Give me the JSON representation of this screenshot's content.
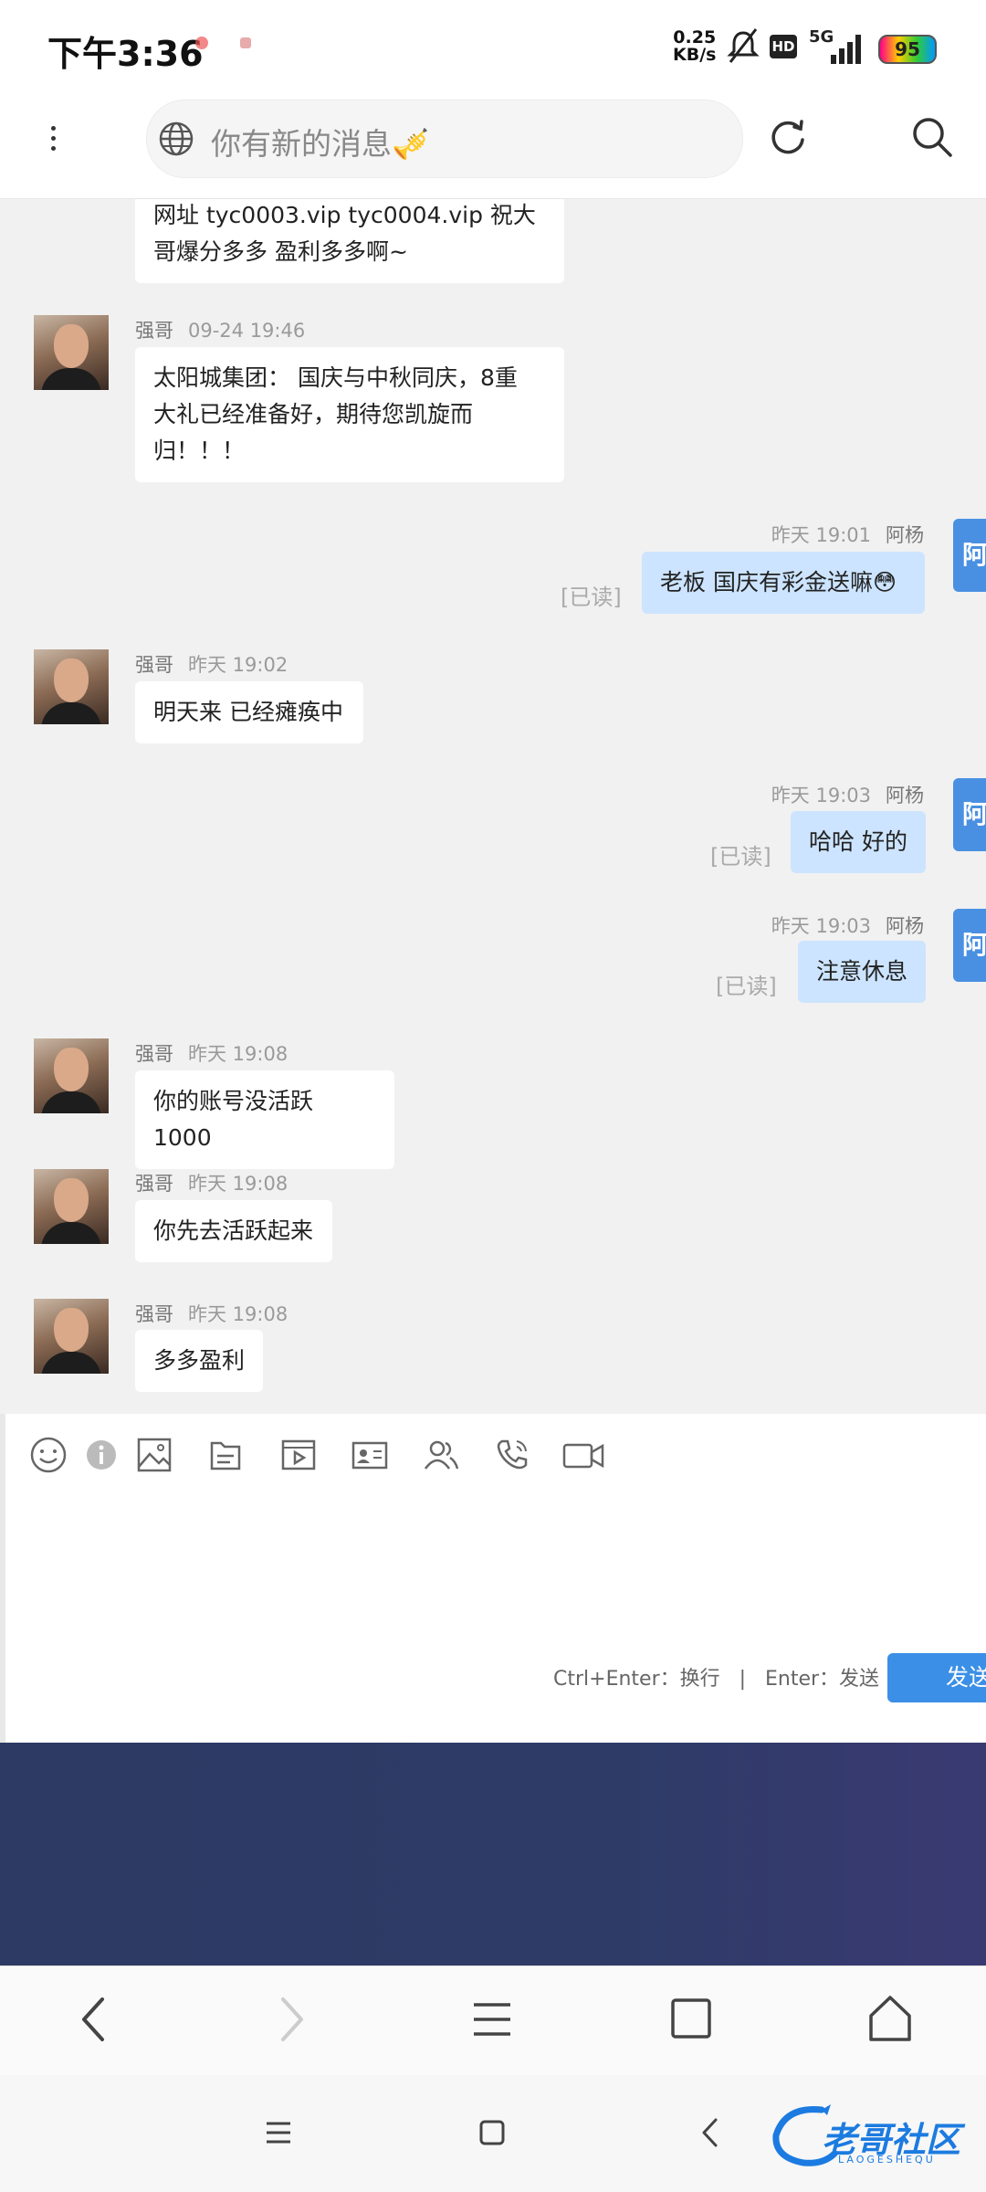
{
  "status_bar": {
    "time": "下午3:36",
    "net_speed_value": "0.25",
    "net_speed_unit": "KB/s",
    "hd_label": "HD",
    "network_label": "5G",
    "battery": "95"
  },
  "top_bar": {
    "search_placeholder": "你有新的消息🎺",
    "icons": [
      "more-vert-icon",
      "globe-icon",
      "refresh-icon",
      "search-icon"
    ]
  },
  "messages": [
    {
      "side": "left",
      "name": "",
      "time": "",
      "lines": [
        "网址 tyc0003.vip tyc0004.vip 祝大",
        "哥爆分多多 盈利多多啊~"
      ]
    },
    {
      "side": "left",
      "name": "强哥",
      "time": "09-24 19:46",
      "lines": [
        "太阳城集团： 国庆与中秋同庆，8重",
        "大礼已经准备好，期待您凯旋而",
        "归！！！"
      ]
    },
    {
      "side": "right",
      "name": "阿杨",
      "time": "昨天 19:01",
      "read": "[已读]",
      "lines": [
        "老板 国庆有彩金送嘛😳"
      ]
    },
    {
      "side": "left",
      "name": "强哥",
      "time": "昨天 19:02",
      "lines": [
        "明天来 已经瘫痪中"
      ]
    },
    {
      "side": "right",
      "name": "阿杨",
      "time": "昨天 19:03",
      "read": "[已读]",
      "lines": [
        "哈哈 好的"
      ]
    },
    {
      "side": "right",
      "name": "阿杨",
      "time": "昨天 19:03",
      "read": "[已读]",
      "lines": [
        "注意休息"
      ]
    },
    {
      "side": "left",
      "name": "强哥",
      "time": "昨天 19:08",
      "lines": [
        "你的账号没活跃 1000"
      ]
    },
    {
      "side": "left",
      "name": "强哥",
      "time": "昨天 19:08",
      "lines": [
        "你先去活跃起来"
      ]
    },
    {
      "side": "left",
      "name": "强哥",
      "time": "昨天 19:08",
      "lines": [
        "多多盈利"
      ]
    }
  ],
  "side_tab_label": "阿",
  "composer": {
    "toolbar_icons": [
      "emoji-icon",
      "info-icon",
      "image-icon",
      "file-icon",
      "video-file-icon",
      "contact-card-icon",
      "group-icon",
      "phone-call-icon",
      "video-call-icon"
    ],
    "hint": "Ctrl+Enter：换行   |   Enter：发送",
    "send_label": "发送"
  },
  "browser_nav": {
    "icons": [
      "back-icon",
      "forward-icon",
      "menu-icon",
      "tabs-icon",
      "home-icon"
    ]
  },
  "system_nav": {
    "icons": [
      "recent-apps-icon",
      "home-square-icon",
      "back-chevron-icon"
    ],
    "watermark": "老哥社区",
    "watermark_sub": "LAOGESHEQU"
  }
}
